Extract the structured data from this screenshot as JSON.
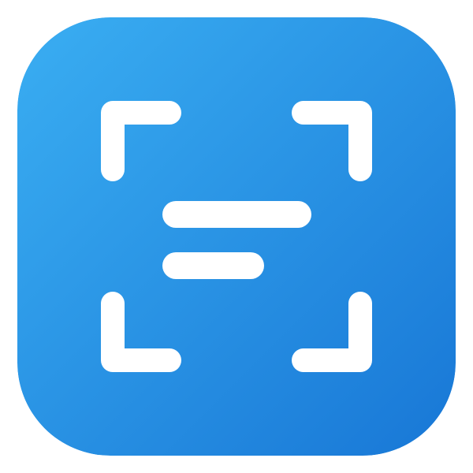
{
  "app_icon": {
    "name": "document-scanner-app-icon",
    "colors": {
      "gradient_start": "#3aaef2",
      "gradient_end": "#1877d6",
      "glyph": "#ffffff",
      "background": "#ffffff"
    },
    "icons": {
      "frame": "scan-frame-icon",
      "text_lines": "text-lines-icon"
    }
  }
}
